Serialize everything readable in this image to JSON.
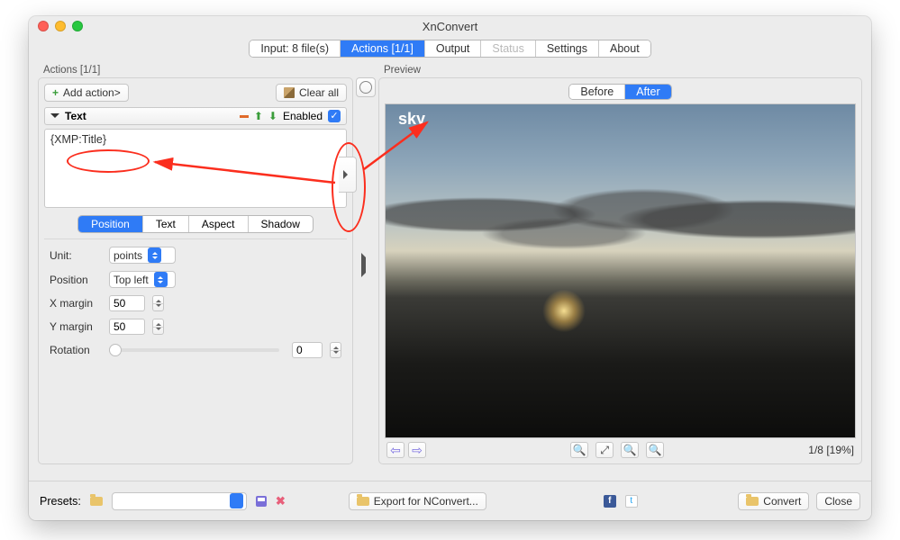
{
  "window": {
    "title": "XnConvert"
  },
  "tabs": {
    "input": "Input: 8 file(s)",
    "actions": "Actions [1/1]",
    "output": "Output",
    "status": "Status",
    "settings": "Settings",
    "about": "About",
    "active": "actions"
  },
  "actions_panel": {
    "label": "Actions [1/1]",
    "add_action": "Add action>",
    "clear_all": "Clear all",
    "action": {
      "name": "Text",
      "enabled_label": "Enabled",
      "text_value": "{XMP:Title}"
    },
    "subtabs": {
      "position": "Position",
      "text": "Text",
      "aspect": "Aspect",
      "shadow": "Shadow"
    },
    "form": {
      "unit_label": "Unit:",
      "unit_value": "points",
      "position_label": "Position",
      "position_value": "Top left",
      "xmargin_label": "X margin",
      "xmargin_value": "50",
      "ymargin_label": "Y margin",
      "ymargin_value": "50",
      "rotation_label": "Rotation",
      "rotation_value": "0"
    }
  },
  "preview_panel": {
    "label": "Preview",
    "before": "Before",
    "after": "After",
    "overlay_text": "sky",
    "counter": "1/8 [19%]"
  },
  "footer": {
    "presets_label": "Presets:",
    "export_label": "Export for NConvert...",
    "convert_label": "Convert",
    "close_label": "Close"
  }
}
